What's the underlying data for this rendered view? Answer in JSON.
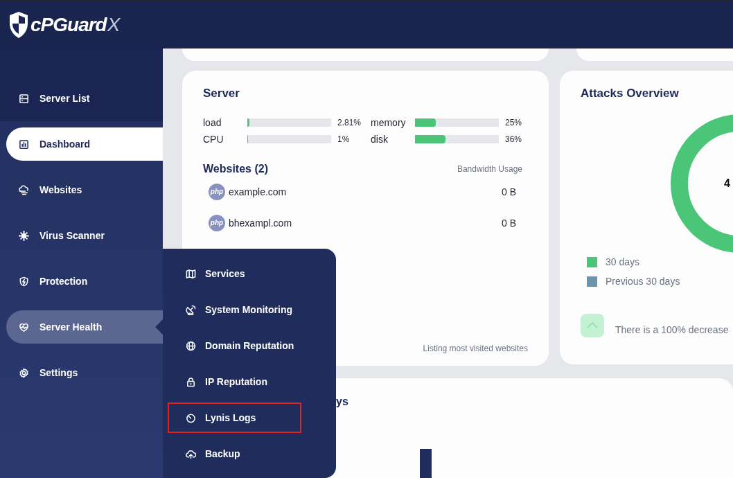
{
  "header": {
    "logo": {
      "name": "cPGuard",
      "suffix": "X"
    }
  },
  "sidebar": {
    "top_link": {
      "label": "Server List"
    },
    "items": [
      {
        "label": "Dashboard",
        "selected": true,
        "expanded": false
      },
      {
        "label": "Websites",
        "selected": false,
        "expanded": false
      },
      {
        "label": "Virus Scanner",
        "selected": false,
        "expanded": false
      },
      {
        "label": "Protection",
        "selected": false,
        "expanded": false
      },
      {
        "label": "Server Health",
        "selected": false,
        "expanded": true,
        "submenu": [
          {
            "label": "Services",
            "highlighted": false
          },
          {
            "label": "System Monitoring",
            "highlighted": false
          },
          {
            "label": "Domain Reputation",
            "highlighted": false
          },
          {
            "label": "IP Reputation",
            "highlighted": false
          },
          {
            "label": "Lynis Logs",
            "highlighted": true
          },
          {
            "label": "Backup",
            "highlighted": false
          }
        ]
      },
      {
        "label": "Settings",
        "selected": false,
        "expanded": false
      }
    ]
  },
  "server": {
    "title": "Server",
    "meters": [
      {
        "name": "load",
        "level": 0.0281,
        "reading": "2.81%"
      },
      {
        "name": "memory",
        "level": 0.25,
        "reading": "25%"
      },
      {
        "name": "CPU",
        "level": 0.01,
        "reading": "1%"
      },
      {
        "name": "disk",
        "level": 0.36,
        "reading": "36%"
      }
    ],
    "websites_title": "Websites (2)",
    "bandwidth_header": "Bandwidth Usage",
    "websites": [
      {
        "badge": "php",
        "domain": "example.com",
        "usage": "0 B"
      },
      {
        "badge": "php",
        "domain": "bhexampl.com",
        "usage": "0 B"
      }
    ],
    "footer": "Listing most visited websites"
  },
  "attacks": {
    "title": "Attacks Overview",
    "center_value": "4",
    "legend": [
      {
        "label": "30 days",
        "color": "#4bc577"
      },
      {
        "label": "Previous 30 days",
        "color": "#6a95ad"
      }
    ],
    "trend": "There is a 100% decrease"
  },
  "bottom_panel": {
    "title": "ys"
  }
}
